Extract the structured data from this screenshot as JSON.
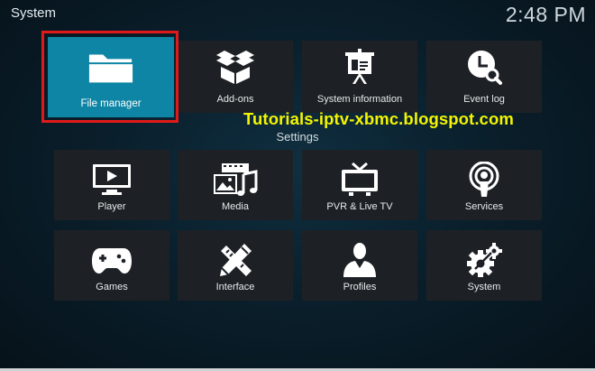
{
  "window_title": "System",
  "clock": "2:48 PM",
  "section_label": "Settings",
  "watermark": "Tutorials-iptv-xbmc.blogspot.com",
  "focused_color": "#0e85a4",
  "highlight_color": "#e01a1a",
  "tiles_row1": [
    {
      "label": "File manager",
      "icon": "folder-icon"
    },
    {
      "label": "Add-ons",
      "icon": "open-box-icon"
    },
    {
      "label": "System information",
      "icon": "presentation-board-icon"
    },
    {
      "label": "Event log",
      "icon": "clock-search-icon"
    }
  ],
  "tiles_row2": [
    {
      "label": "Player",
      "icon": "play-screen-icon"
    },
    {
      "label": "Media",
      "icon": "media-icon"
    },
    {
      "label": "PVR & Live TV",
      "icon": "tv-icon"
    },
    {
      "label": "Services",
      "icon": "podcast-icon"
    }
  ],
  "tiles_row3": [
    {
      "label": "Games",
      "icon": "gamepad-icon"
    },
    {
      "label": "Interface",
      "icon": "pencil-ruler-icon"
    },
    {
      "label": "Profiles",
      "icon": "user-profile-icon"
    },
    {
      "label": "System",
      "icon": "gears-icon"
    }
  ]
}
